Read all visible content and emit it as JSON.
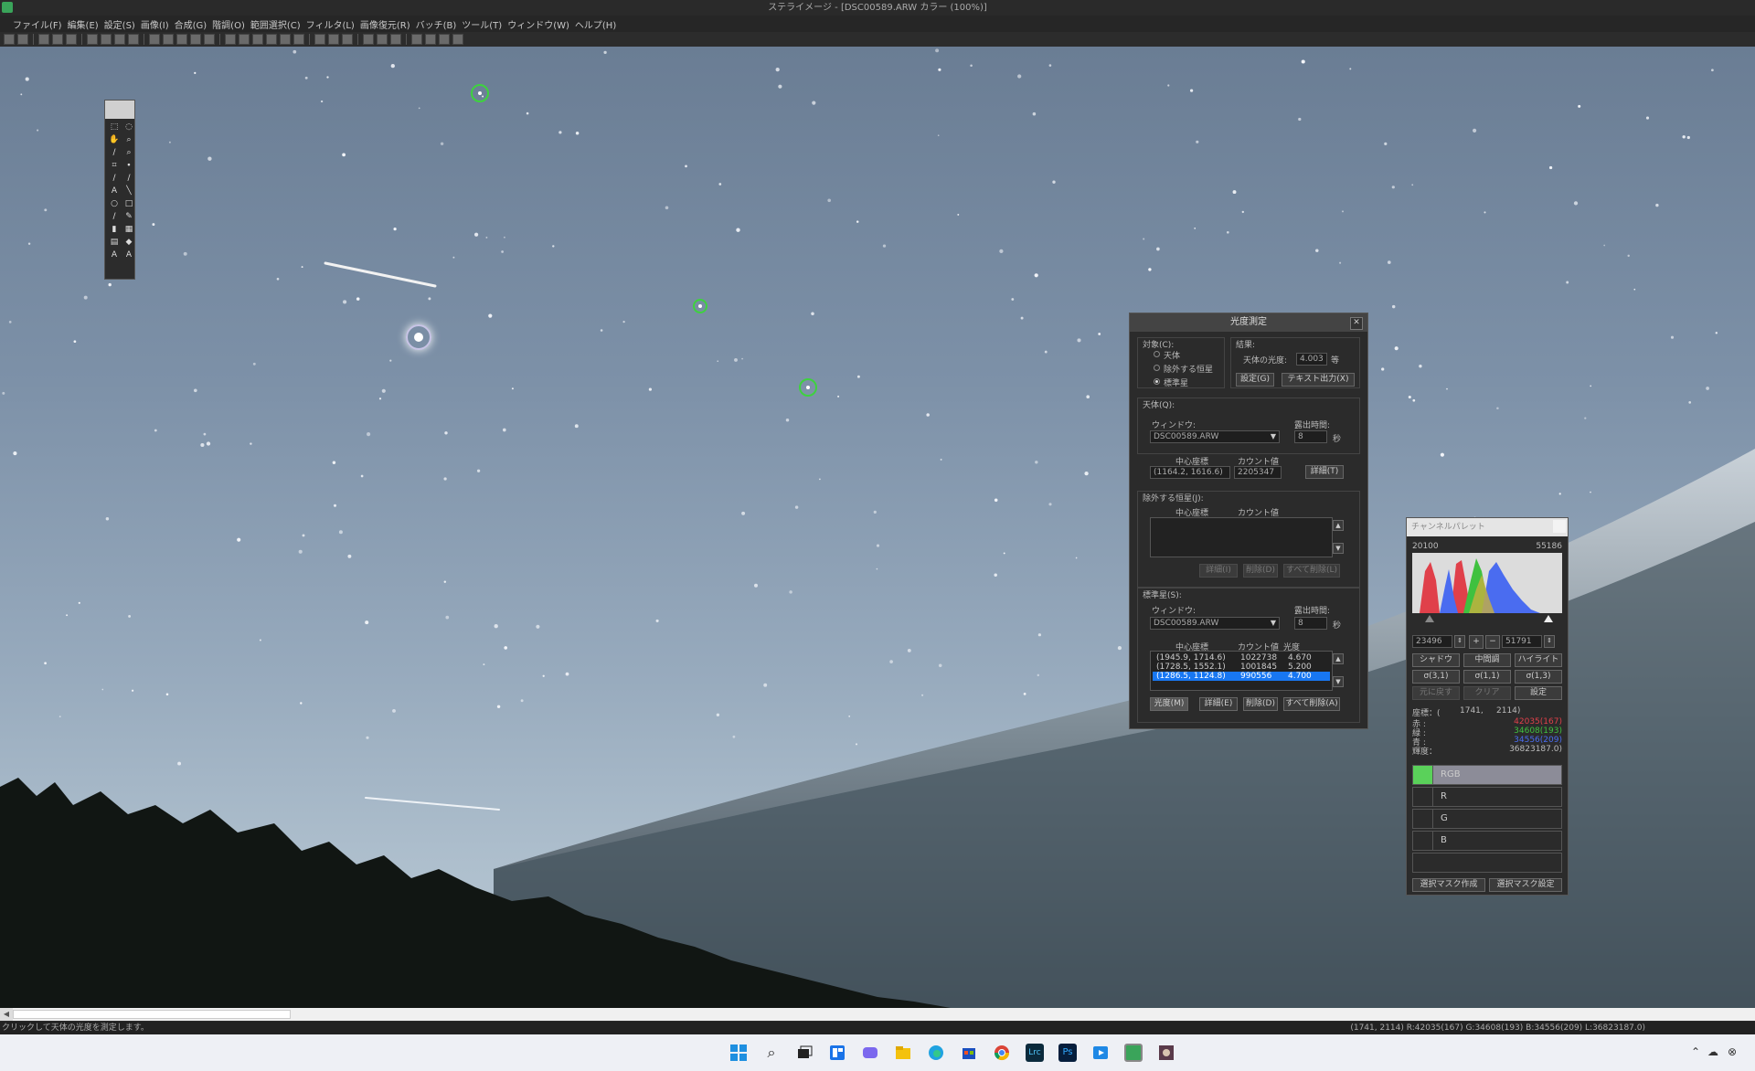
{
  "window": {
    "title": "ステライメージ - [DSC00589.ARW カラー (100%)]"
  },
  "menu": [
    "ファイル(F)",
    "編集(E)",
    "設定(S)",
    "画像(I)",
    "合成(G)",
    "階調(O)",
    "範囲選択(C)",
    "フィルタ(L)",
    "画像復元(R)",
    "バッチ(B)",
    "ツール(T)",
    "ウィンドウ(W)",
    "ヘルプ(H)"
  ],
  "photometry": {
    "title": "光度測定",
    "close": "✕",
    "target_label": "対象(C):",
    "target_options": [
      "天体",
      "除外する恒星",
      "標準星"
    ],
    "target_selected": "標準星",
    "result_label": "結果:",
    "brightness_label": "天体の光度:",
    "brightness_value": "4.003",
    "brightness_unit": "等",
    "settings_button": "設定(G)",
    "text_output_button": "テキスト出力(X)",
    "object_section": "天体(Q):",
    "window_label": "ウィンドウ:",
    "window_value": "DSC00589.ARW",
    "exposure_label": "露出時間:",
    "exposure_value": "8",
    "exposure_unit": "秒",
    "center_label": "中心座標",
    "count_label": "カウント値",
    "object_center": "(1164.2, 1616.6)",
    "object_count": "2205347",
    "detail_button": "詳細(T)",
    "exclude_section": "除外する恒星(J):",
    "exclude_center_label": "中心座標",
    "exclude_count_label": "カウント値",
    "exclude_detail_button": "詳細(I)",
    "exclude_delete_button": "削除(D)",
    "exclude_delete_all_button": "すべて削除(L)",
    "standard_section": "標準星(S):",
    "std_window_label": "ウィンドウ:",
    "std_window_value": "DSC00589.ARW",
    "std_exposure_label": "露出時間:",
    "std_exposure_value": "8",
    "std_exposure_unit": "秒",
    "std_center_label": "中心座標",
    "std_count_label": "カウント値",
    "std_mag_label": "光度",
    "std_rows": [
      {
        "center": "(1945.9, 1714.6)",
        "count": "1022738",
        "mag": "4.670"
      },
      {
        "center": "(1728.5, 1552.1)",
        "count": "1001845",
        "mag": "5.200"
      },
      {
        "center": "(1286.5, 1124.8)",
        "count": "990556",
        "mag": "4.700"
      }
    ],
    "brightness_button": "光度(M)",
    "std_detail_button": "詳細(E)",
    "std_delete_button": "削除(D)",
    "std_delete_all_button": "すべて削除(A)"
  },
  "channel": {
    "title": "チャンネルパレット",
    "hist_min": "20100",
    "hist_max": "55186",
    "low_value": "23496",
    "high_value": "51791",
    "plus": "+",
    "minus": "−",
    "buttons_row1": [
      "シャドウ",
      "中間調",
      "ハイライト"
    ],
    "buttons_row2": [
      "σ(3,1)",
      "σ(1,1)",
      "σ(1,3)"
    ],
    "buttons_row3": [
      "元に戻す",
      "クリア",
      "設定"
    ],
    "coord_label": "座標：(",
    "coord_x": "1741,",
    "coord_y": "2114)",
    "red_label": "赤  :",
    "green_label": "緑  :",
    "blue_label": "青  :",
    "luma_label": "輝度：",
    "red_value": "42035(167)",
    "green_value": "34608(193)",
    "blue_value": "34556(209)",
    "luma_value": "36823187.0)",
    "rows": [
      "RGB",
      "R",
      "G",
      "B"
    ],
    "mask_create_button": "選択マスク作成",
    "mask_settings_button": "選択マスク設定",
    "colors": {
      "red": "#e0404a",
      "green": "#3fc13f",
      "blue": "#4a6cf0"
    }
  },
  "status": {
    "left": "クリックして天体の光度を測定します。",
    "right": "(1741, 2114) R:42035(167) G:34608(193) B:34556(209) L:36823187.0)"
  },
  "taskbar": {
    "icons": [
      "windows-start-icon",
      "search-icon",
      "task-view-icon",
      "widgets-icon",
      "chat-icon",
      "file-explorer-icon",
      "edge-icon",
      "store-icon",
      "chrome-icon",
      "lightroom-icon",
      "photoshop-icon",
      "media-player-icon",
      "stellaimage-icon",
      "game-icon"
    ],
    "lrc_label": "Lrc",
    "ps_label": "Ps"
  }
}
